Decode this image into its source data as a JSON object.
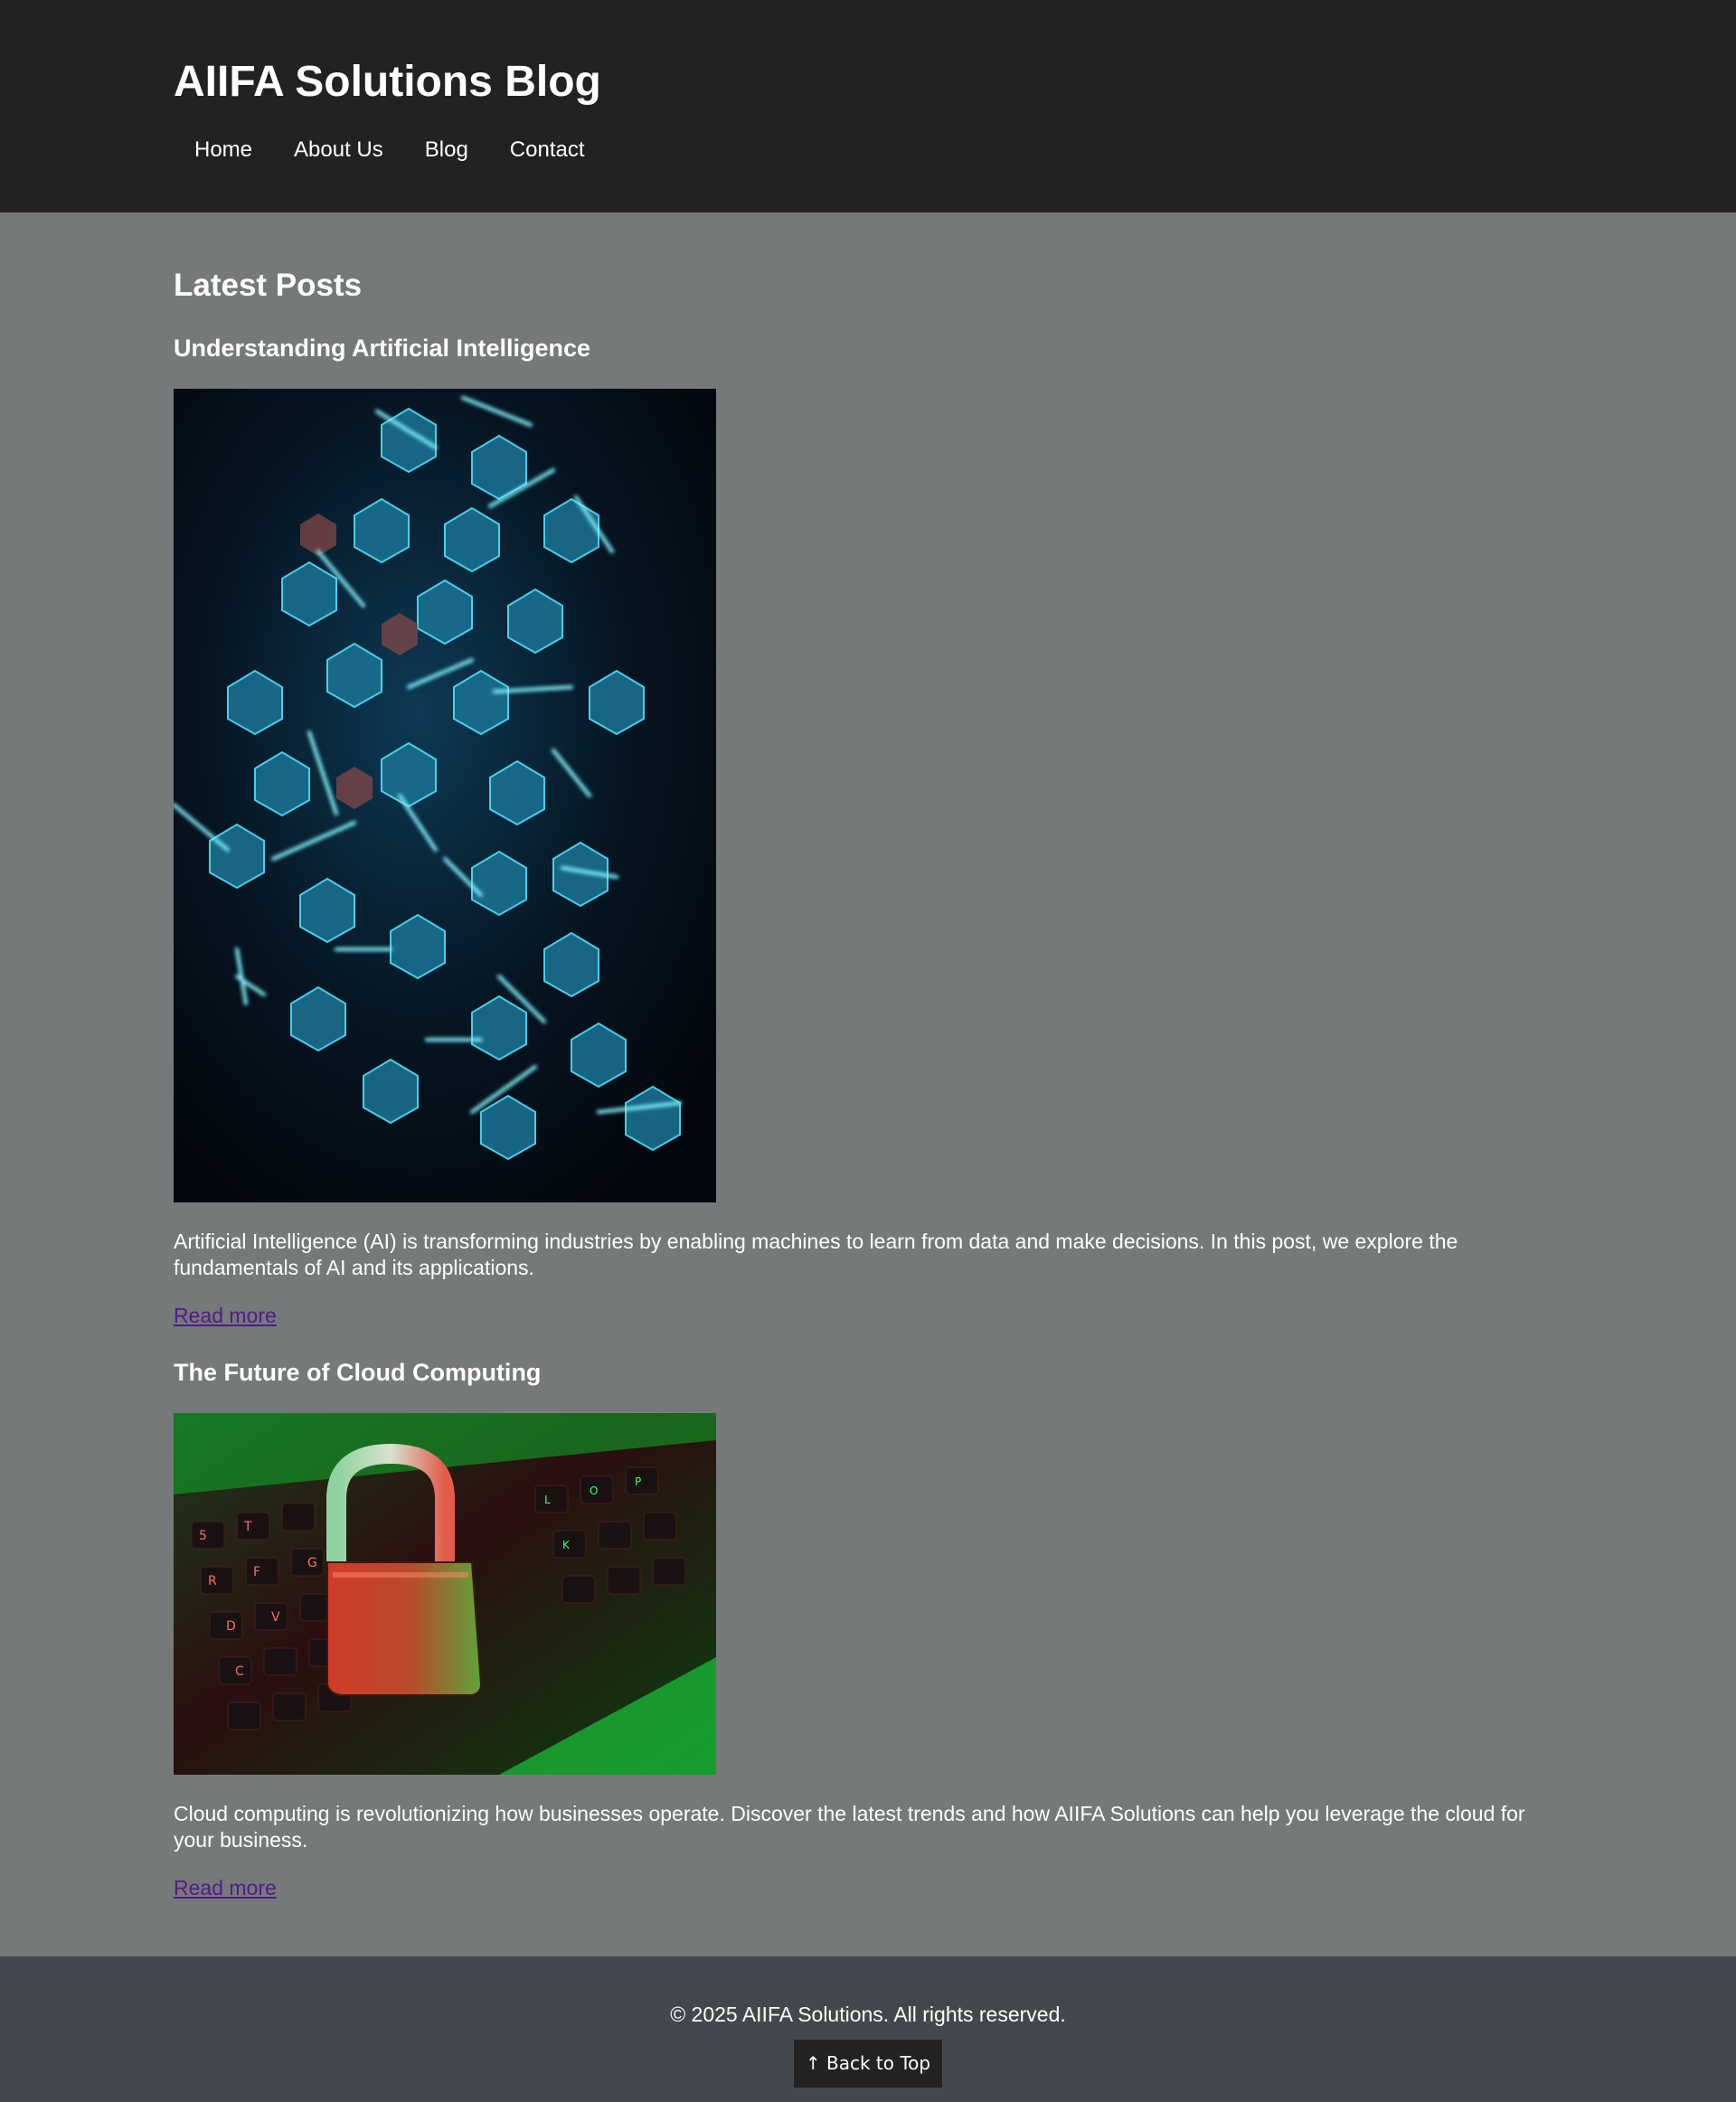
{
  "header": {
    "site_title": "AIIFA Solutions Blog",
    "nav": [
      {
        "label": "Home"
      },
      {
        "label": "About Us"
      },
      {
        "label": "Blog"
      },
      {
        "label": "Contact"
      }
    ]
  },
  "main": {
    "section_title": "Latest Posts",
    "posts": [
      {
        "title": "Understanding Artificial Intelligence",
        "image_icon": "glowing-hexagon-network-image",
        "excerpt": "Artificial Intelligence (AI) is transforming industries by enabling machines to learn from data and make decisions. In this post, we explore the fundamentals of AI and its applications.",
        "link_label": "Read more"
      },
      {
        "title": "The Future of Cloud Computing",
        "image_icon": "padlock-on-keyboard-image",
        "excerpt": "Cloud computing is revolutionizing how businesses operate. Discover the latest trends and how AIIFA Solutions can help you leverage the cloud for your business.",
        "link_label": "Read more"
      }
    ]
  },
  "footer": {
    "copyright": "© 2025 AIIFA Solutions. All rights reserved.",
    "back_to_top": "↑ Back to Top"
  },
  "colors": {
    "header_bg": "#232220",
    "page_bg": "#75797a",
    "footer_bg": "#43484f",
    "link": "#551a8b",
    "button_bg": "#232323"
  }
}
